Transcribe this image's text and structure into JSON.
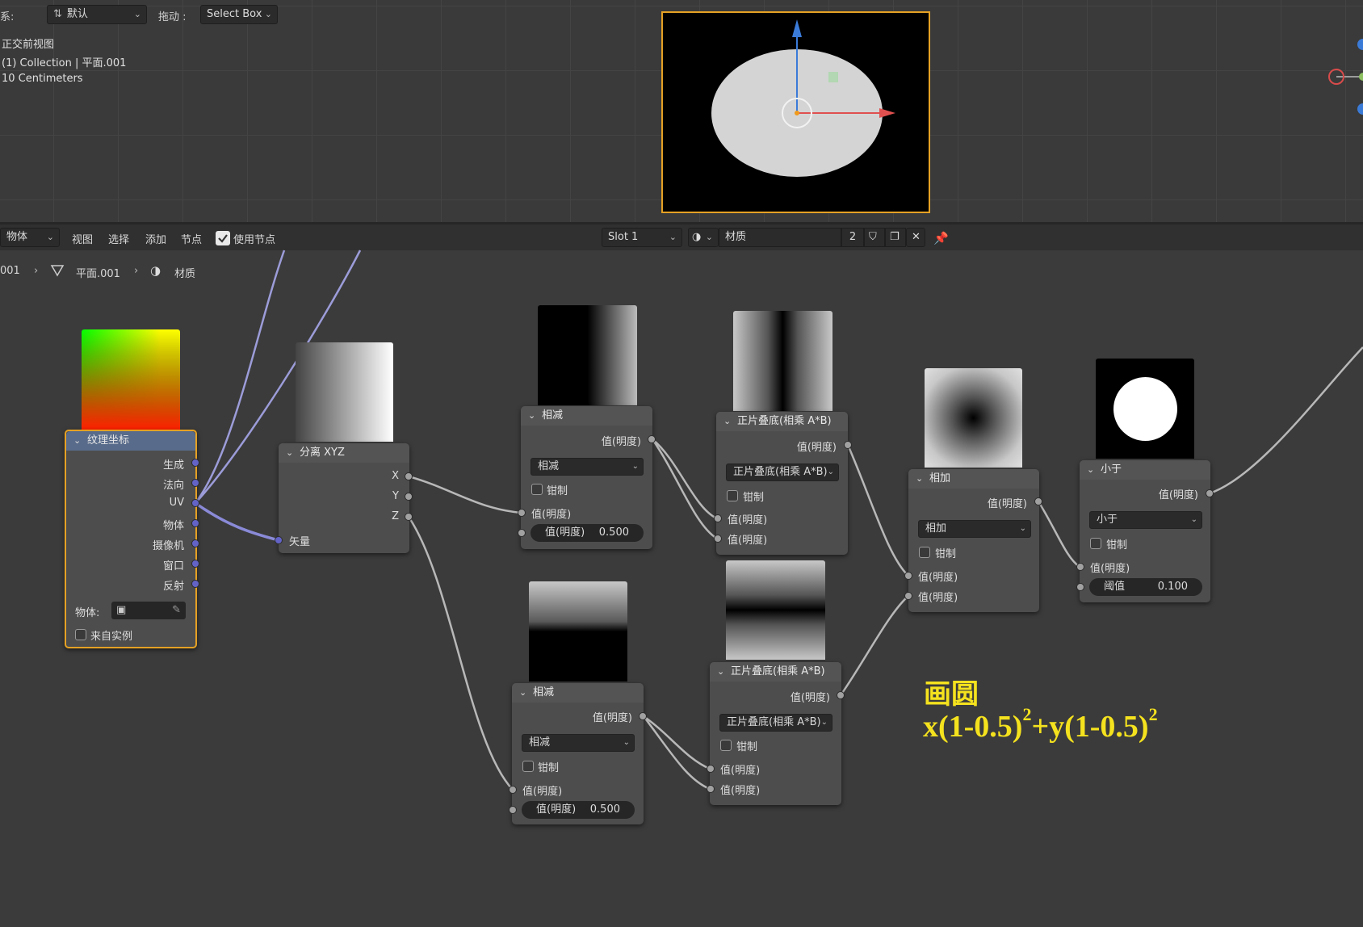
{
  "viewport_header": {
    "coord_label": "系:",
    "coord_value": "默认",
    "drag_label": "拖动 :",
    "drag_value": "Select Box"
  },
  "viewport_overlay": {
    "view_name": "正交前视图",
    "collection": "(1) Collection | 平面.001",
    "scale": "10 Centimeters"
  },
  "node_header": {
    "editor_type": "物体",
    "menus": [
      "视图",
      "选择",
      "添加",
      "节点"
    ],
    "use_nodes_label": "使用节点",
    "slot": "Slot 1",
    "material_name": "材质",
    "user_count": "2"
  },
  "breadcrumb": {
    "object": "001",
    "mesh": "平面.001",
    "material": "材质"
  },
  "colors": {
    "accent_orange": "#e5a124",
    "vector_socket": "#6363c7",
    "value_socket": "#a1a1a1",
    "annotation": "#f5e21e"
  },
  "nodes": {
    "texcoord": {
      "title": "纹理坐标",
      "outputs": [
        "生成",
        "法向",
        "UV",
        "物体",
        "摄像机",
        "窗口",
        "反射"
      ],
      "object_label": "物体:",
      "from_instancer": "来自实例"
    },
    "separate": {
      "title": "分离 XYZ",
      "outputs": [
        "X",
        "Y",
        "Z"
      ],
      "input": "矢量"
    },
    "subtract_top": {
      "title": "相减",
      "output": "值(明度)",
      "operation": "相减",
      "clamp": "钳制",
      "input_a": "值(明度)",
      "input_b_label": "值(明度)",
      "input_b_value": "0.500"
    },
    "subtract_bottom": {
      "title": "相减",
      "output": "值(明度)",
      "operation": "相减",
      "clamp": "钳制",
      "input_a": "值(明度)",
      "input_b_label": "值(明度)",
      "input_b_value": "0.500"
    },
    "multiply_top": {
      "title": "正片叠底(相乘 A*B)",
      "output": "值(明度)",
      "operation": "正片叠底(相乘 A*B)",
      "clamp": "钳制",
      "input_a": "值(明度)",
      "input_b": "值(明度)"
    },
    "multiply_bottom": {
      "title": "正片叠底(相乘 A*B)",
      "output": "值(明度)",
      "operation": "正片叠底(相乘 A*B)",
      "clamp": "钳制",
      "input_a": "值(明度)",
      "input_b": "值(明度)"
    },
    "add": {
      "title": "相加",
      "output": "值(明度)",
      "operation": "相加",
      "clamp": "钳制",
      "input_a": "值(明度)",
      "input_b": "值(明度)"
    },
    "less_than": {
      "title": "小于",
      "output": "值(明度)",
      "operation": "小于",
      "clamp": "钳制",
      "input_a": "值(明度)",
      "threshold_label": "阈值",
      "threshold_value": "0.100"
    }
  },
  "annotation": {
    "title": "画圆",
    "formula_part1": "x(1-0.5)",
    "sup1": "2",
    "formula_part2": "+y(1-0.5)",
    "sup2": "2"
  }
}
